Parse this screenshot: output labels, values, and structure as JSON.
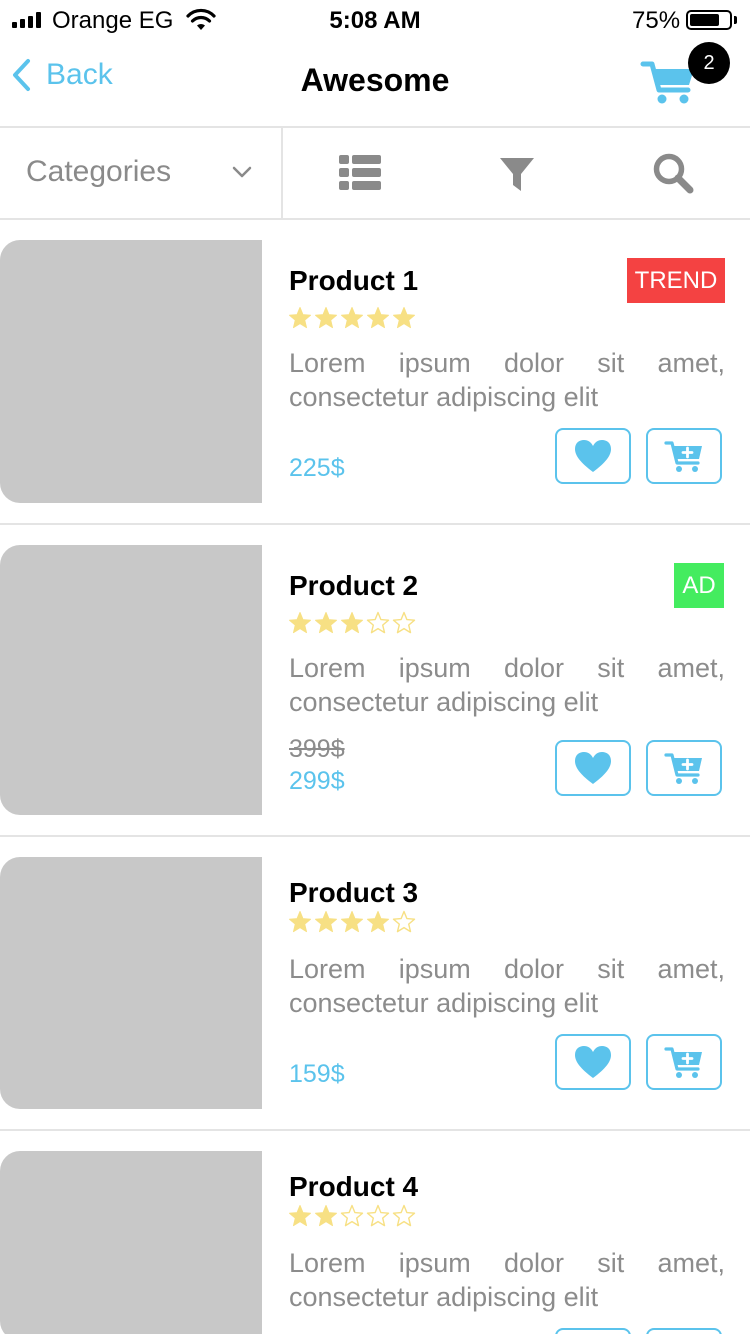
{
  "status_bar": {
    "carrier": "Orange EG",
    "time": "5:08 AM",
    "battery": "75%",
    "battery_level": 0.75
  },
  "nav": {
    "back_label": "Back",
    "title": "Awesome",
    "cart_count": "2"
  },
  "toolbar": {
    "categories_label": "Categories",
    "icons": [
      "list-icon",
      "filter-icon",
      "search-icon"
    ]
  },
  "colors": {
    "accent": "#5bc3ec",
    "trend_badge": "#f44242",
    "ad_badge": "#44ec5f",
    "star": "#f7e084",
    "placeholder": "#c8c8c8"
  },
  "products": [
    {
      "name": "Product 1",
      "rating": 5,
      "badge": "TREND",
      "description_line1": "Lorem ipsum dolor sit amet,",
      "description_line2": "consectetur adipiscing elit",
      "old_price": "",
      "price": "225$"
    },
    {
      "name": "Product 2",
      "rating": 3,
      "badge": "AD",
      "description_line1": "Lorem ipsum dolor sit amet,",
      "description_line2": "consectetur adipiscing elit",
      "old_price": "399$",
      "price": "299$"
    },
    {
      "name": "Product 3",
      "rating": 4,
      "badge": "",
      "description_line1": "Lorem ipsum dolor sit amet,",
      "description_line2": "consectetur adipiscing elit",
      "old_price": "",
      "price": "159$"
    },
    {
      "name": "Product 4",
      "rating": 2,
      "badge": "",
      "description_line1": "Lorem ipsum dolor sit amet,",
      "description_line2": "consectetur adipiscing elit",
      "old_price": "",
      "price": ""
    }
  ]
}
